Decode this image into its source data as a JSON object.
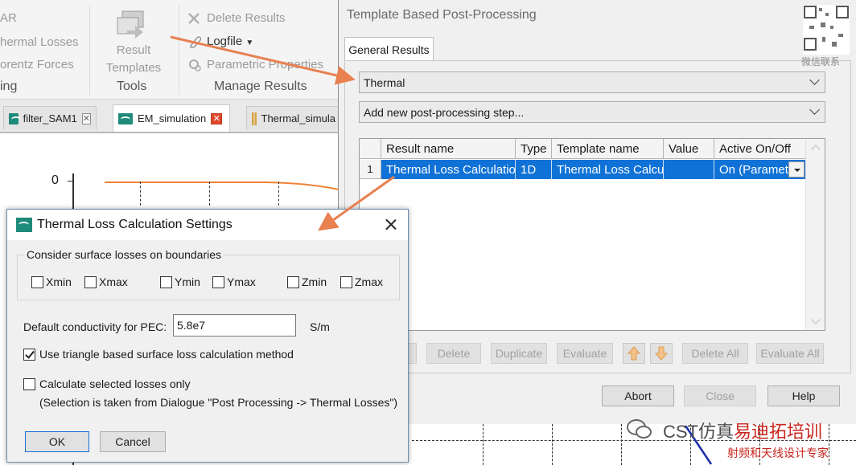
{
  "ribbon": {
    "items_left": [
      "AR",
      "hermal Losses",
      "orentz Forces",
      "ing"
    ],
    "result_templates_label": "Result Templates",
    "tools_group": "Tools",
    "delete_results": "Delete Results",
    "logfile": "Logfile",
    "parametric_properties": "Parametric Properties",
    "manage_results_group": "Manage Results"
  },
  "tabs": [
    {
      "label": "filter_SAM1"
    },
    {
      "label": "EM_simulation"
    },
    {
      "label": "Thermal_simula"
    }
  ],
  "plot": {
    "tick_zero": "0"
  },
  "template_dialog": {
    "title": "Template Based Post-Processing",
    "tab": "General Results",
    "result_type": "Thermal",
    "add_step": "Add new post-processing step...",
    "columns": [
      "Result name",
      "Type",
      "Template name",
      "Value",
      "Active On/Off"
    ],
    "rows": [
      {
        "index": "1",
        "result_name": "Thermal Loss Calculation",
        "type": "1D",
        "template_name": "Thermal Loss Calculation",
        "value": "",
        "active": "On (Parametric)"
      }
    ],
    "buttons": {
      "delete": "Delete",
      "duplicate": "Duplicate",
      "evaluate": "Evaluate",
      "delete_all": "Delete All",
      "evaluate_all": "Evaluate All",
      "abort": "Abort",
      "close": "Close",
      "help": "Help"
    }
  },
  "thermal_dialog": {
    "title": "Thermal Loss Calculation Settings",
    "boundaries_legend": "Consider surface losses on boundaries",
    "boundaries": [
      "Xmin",
      "Xmax",
      "Ymin",
      "Ymax",
      "Zmin",
      "Zmax"
    ],
    "conductivity_label": "Default conductivity for PEC:",
    "conductivity_value": "5.8e7",
    "conductivity_unit": "S/m",
    "triangle_method": "Use triangle based surface loss calculation method",
    "selected_losses": "Calculate selected losses only",
    "selection_note": "(Selection is taken from Dialogue \"Post Processing -> Thermal Losses\")",
    "ok": "OK",
    "cancel": "Cancel"
  },
  "watermark": {
    "qr_caption": "微信联系",
    "brand": "CST仿真",
    "brand_red": "易迪拓培训",
    "tagline": "射频和天线设计专家"
  },
  "colors": {
    "selection": "#1072d6",
    "callout": "#e8804f",
    "icon_teal": "#1e8a7a"
  }
}
